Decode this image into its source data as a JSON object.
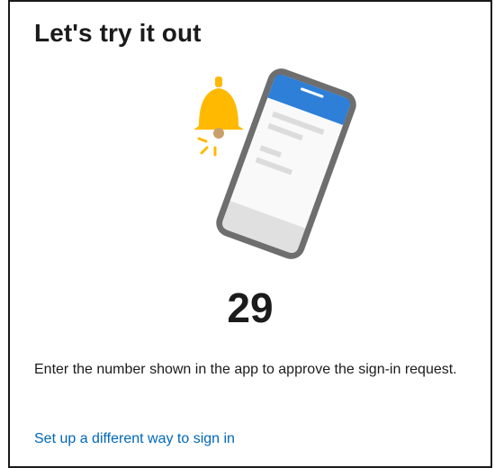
{
  "dialog": {
    "title": "Let's try it out",
    "code": "29",
    "instructions": "Enter the number shown in the app to approve the sign-in request.",
    "link_label": "Set up a different way to sign in"
  },
  "illustration": {
    "icon": "phone-notification-illustration",
    "bell_color": "#ffb900",
    "phone_header_color": "#2d7fd8",
    "phone_frame_color": "#6e6e6e"
  },
  "colors": {
    "link": "#0067b8",
    "text": "#1b1b1b"
  }
}
